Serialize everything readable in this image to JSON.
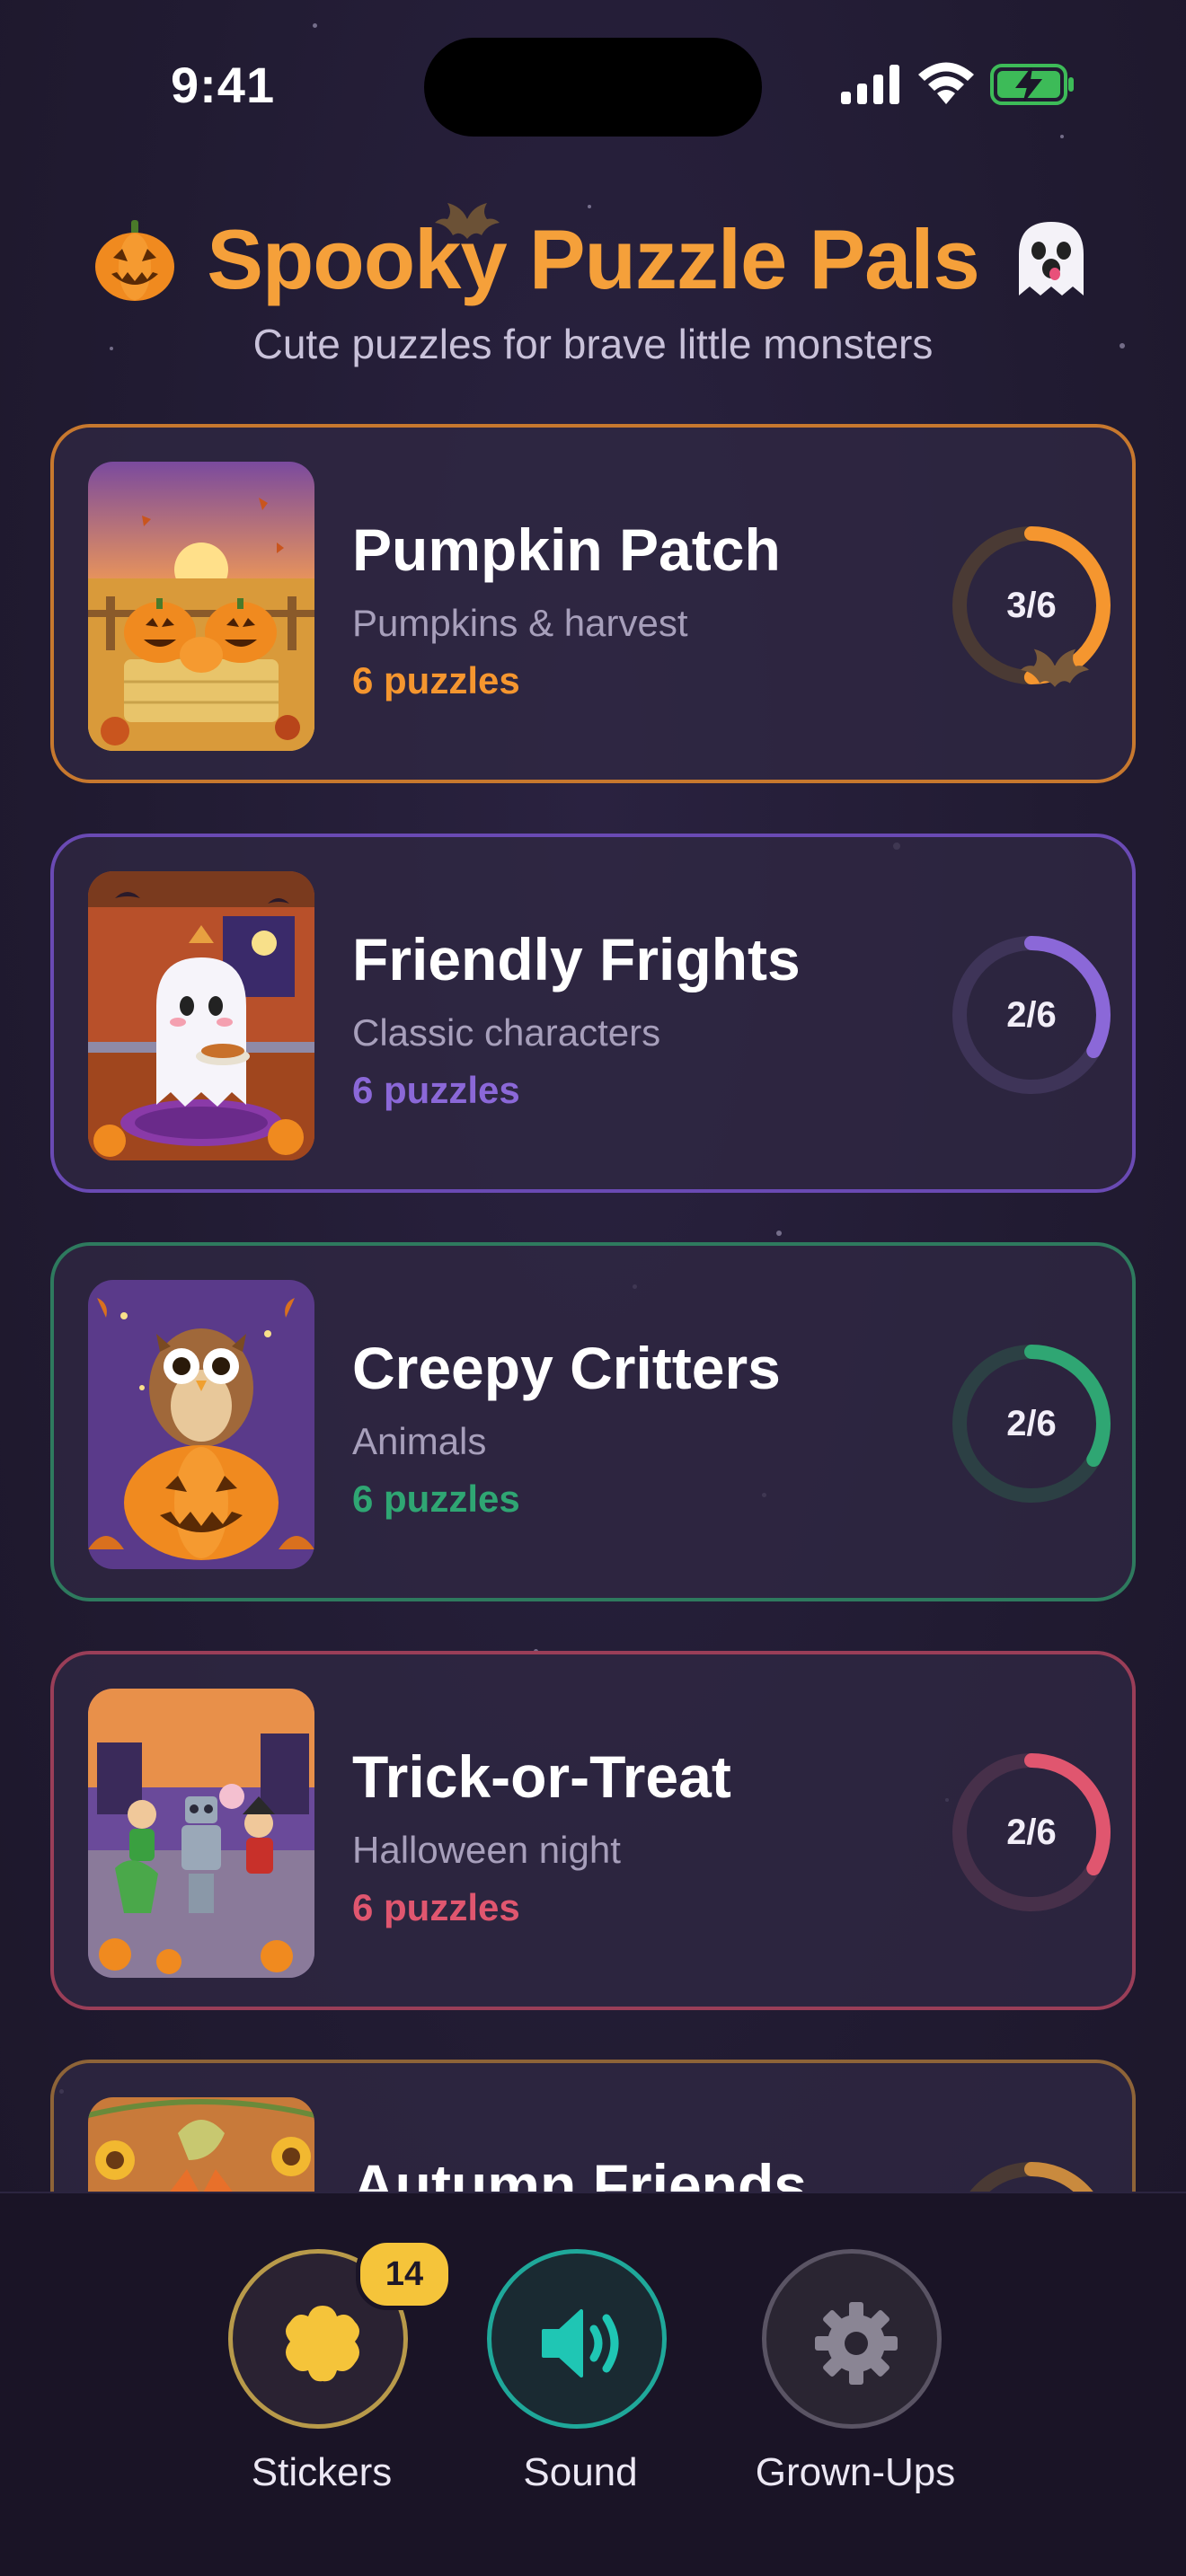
{
  "status_bar": {
    "time": "9:41",
    "icons": [
      "signal-icon",
      "wifi-icon",
      "battery-charging-icon"
    ]
  },
  "header": {
    "title": "Spooky Puzzle Pals",
    "subtitle": "Cute puzzles for brave little monsters",
    "icons": [
      "jack-o-lantern-icon",
      "ghost-icon",
      "bat-icon"
    ],
    "accent": "#f5a03a"
  },
  "categories": [
    {
      "title": "Pumpkin Patch",
      "subtitle": "Pumpkins & harvest",
      "count_label": "6 puzzles",
      "progress_label": "3/6",
      "progress": 0.5,
      "color": "#f5962f",
      "thumbnail_icon": "pumpkin-patch-thumbnail"
    },
    {
      "title": "Friendly Frights",
      "subtitle": "Classic characters",
      "count_label": "6 puzzles",
      "progress_label": "2/6",
      "progress": 0.3333,
      "color": "#8b68d8",
      "thumbnail_icon": "friendly-ghost-thumbnail"
    },
    {
      "title": "Creepy Critters",
      "subtitle": "Animals",
      "count_label": "6 puzzles",
      "progress_label": "2/6",
      "progress": 0.3333,
      "color": "#2fa673",
      "thumbnail_icon": "owl-pumpkin-thumbnail"
    },
    {
      "title": "Trick-or-Treat",
      "subtitle": "Halloween night",
      "count_label": "6 puzzles",
      "progress_label": "2/6",
      "progress": 0.3333,
      "color": "#e0566f",
      "thumbnail_icon": "trick-or-treat-kids-thumbnail"
    },
    {
      "title": "Autumn Friends",
      "subtitle": "",
      "count_label": "",
      "progress_label": "",
      "progress": 0.3333,
      "color": "#c98a3e",
      "thumbnail_icon": "autumn-fox-thumbnail"
    }
  ],
  "bottom_nav": {
    "stickers": {
      "label": "Stickers",
      "badge": "14",
      "icon": "sticker-flower-icon",
      "color": "#f5c43a"
    },
    "sound": {
      "label": "Sound",
      "icon": "speaker-icon",
      "color": "#1fc6b4"
    },
    "grownups": {
      "label": "Grown-Ups",
      "icon": "gear-icon",
      "color": "#8a8594"
    }
  }
}
